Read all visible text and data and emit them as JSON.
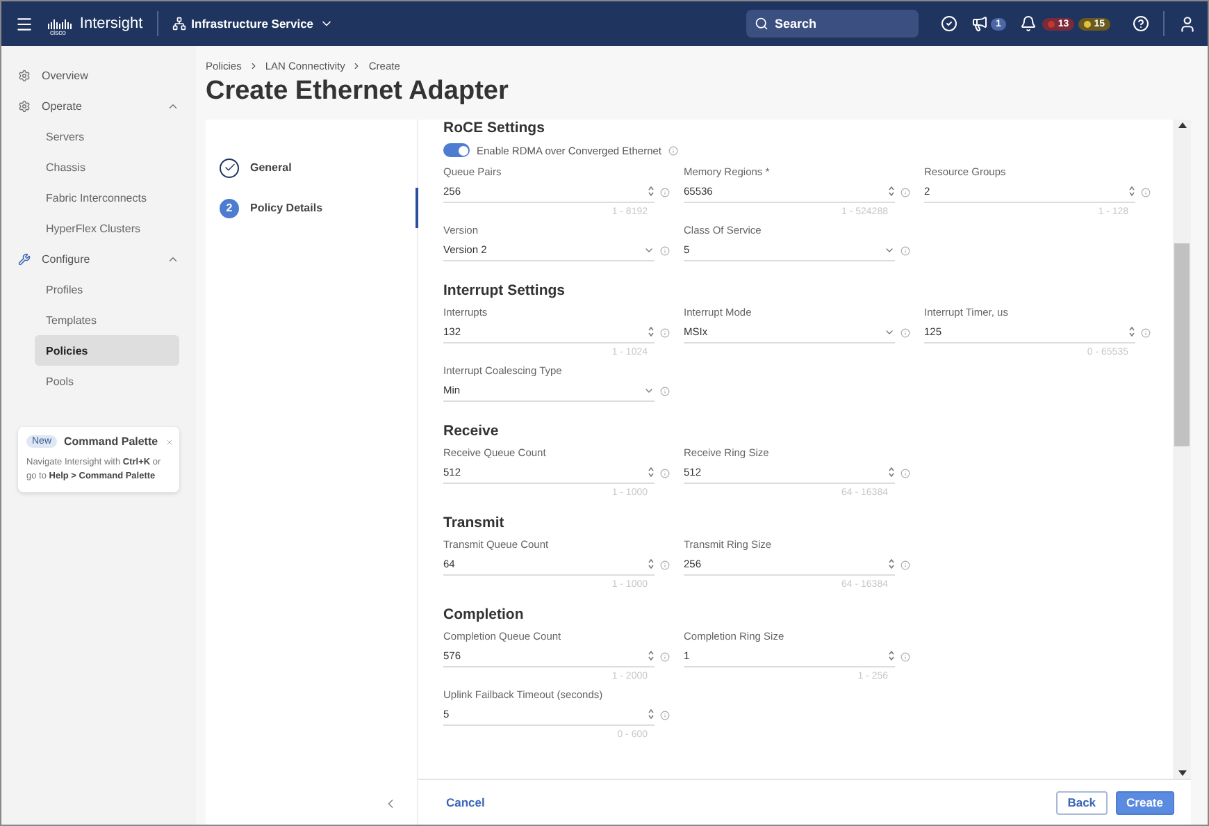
{
  "topbar": {
    "logo_word": "cisco",
    "app_name": "Intersight",
    "service": "Infrastructure Service",
    "search": {
      "placeholder": "Search"
    },
    "announcement_count": "1",
    "alarms": [
      {
        "kind": "critical",
        "count": "13",
        "color": "#c0392b"
      },
      {
        "kind": "warning",
        "count": "15",
        "color": "#e3c13b"
      }
    ]
  },
  "sidebar": {
    "items": [
      {
        "label": "Overview",
        "selected": false
      },
      {
        "label": "Operate",
        "expanded": true,
        "children": [
          {
            "label": "Servers",
            "selected": false
          },
          {
            "label": "Chassis",
            "selected": false
          },
          {
            "label": "Fabric Interconnects",
            "selected": false
          },
          {
            "label": "HyperFlex Clusters",
            "selected": false
          }
        ]
      },
      {
        "label": "Configure",
        "expanded": true,
        "children": [
          {
            "label": "Profiles",
            "selected": false
          },
          {
            "label": "Templates",
            "selected": false
          },
          {
            "label": "Policies",
            "selected": true
          },
          {
            "label": "Pools",
            "selected": false
          }
        ]
      }
    ],
    "promo": {
      "badge": "New",
      "title": "Command Palette",
      "text": "Navigate Intersight with **Ctrl+K** or go to **Help > Command Palette**"
    }
  },
  "breadcrumb": [
    "Policies",
    "LAN Connectivity",
    "Create"
  ],
  "title": "Create Ethernet Adapter",
  "steps": [
    {
      "label": "General",
      "done": true,
      "selected": false
    },
    {
      "label": "Policy Details",
      "number": "2",
      "done": false,
      "selected": true
    }
  ],
  "sections": [
    {
      "title": "RoCE Settings",
      "toggle": {
        "label": "Enable RDMA over Converged Ethernet",
        "on": true
      },
      "rows": [
        [
          {
            "kind": "number",
            "label": "Queue Pairs",
            "value": "256",
            "range": "1 - 8192"
          },
          {
            "kind": "number",
            "label": "Memory Regions *",
            "value": "65536",
            "range": "1 - 524288"
          },
          {
            "kind": "number",
            "label": "Resource Groups",
            "value": "2",
            "range": "1 - 128"
          }
        ],
        [
          {
            "kind": "select",
            "label": "Version",
            "value": "Version 2"
          },
          {
            "kind": "select",
            "label": "Class Of Service",
            "value": "5"
          }
        ]
      ]
    },
    {
      "title": "Interrupt Settings",
      "rows": [
        [
          {
            "kind": "number",
            "label": "Interrupts",
            "value": "132",
            "range": "1 - 1024"
          },
          {
            "kind": "select",
            "label": "Interrupt Mode",
            "value": "MSIx"
          },
          {
            "kind": "number",
            "label": "Interrupt Timer, us",
            "value": "125",
            "range": "0 - 65535"
          }
        ],
        [
          {
            "kind": "select",
            "label": "Interrupt Coalescing Type",
            "value": "Min"
          }
        ]
      ]
    },
    {
      "title": "Receive",
      "rows": [
        [
          {
            "kind": "number",
            "label": "Receive Queue Count",
            "value": "512",
            "range": "1 - 1000"
          },
          {
            "kind": "number",
            "label": "Receive Ring Size",
            "value": "512",
            "range": "64 - 16384"
          }
        ]
      ]
    },
    {
      "title": "Transmit",
      "rows": [
        [
          {
            "kind": "number",
            "label": "Transmit Queue Count",
            "value": "64",
            "range": "1 - 1000"
          },
          {
            "kind": "number",
            "label": "Transmit Ring Size",
            "value": "256",
            "range": "64 - 16384"
          }
        ]
      ]
    },
    {
      "title": "Completion",
      "rows": [
        [
          {
            "kind": "number",
            "label": "Completion Queue Count",
            "value": "576",
            "range": "1 - 2000"
          },
          {
            "kind": "number",
            "label": "Completion Ring Size",
            "value": "1",
            "range": "1 - 256"
          }
        ],
        [
          {
            "kind": "number",
            "label": "Uplink Failback Timeout (seconds)",
            "value": "5",
            "range": "0 - 600"
          }
        ]
      ]
    }
  ],
  "footer": {
    "cancel": "Cancel",
    "back": "Back",
    "create": "Create"
  }
}
